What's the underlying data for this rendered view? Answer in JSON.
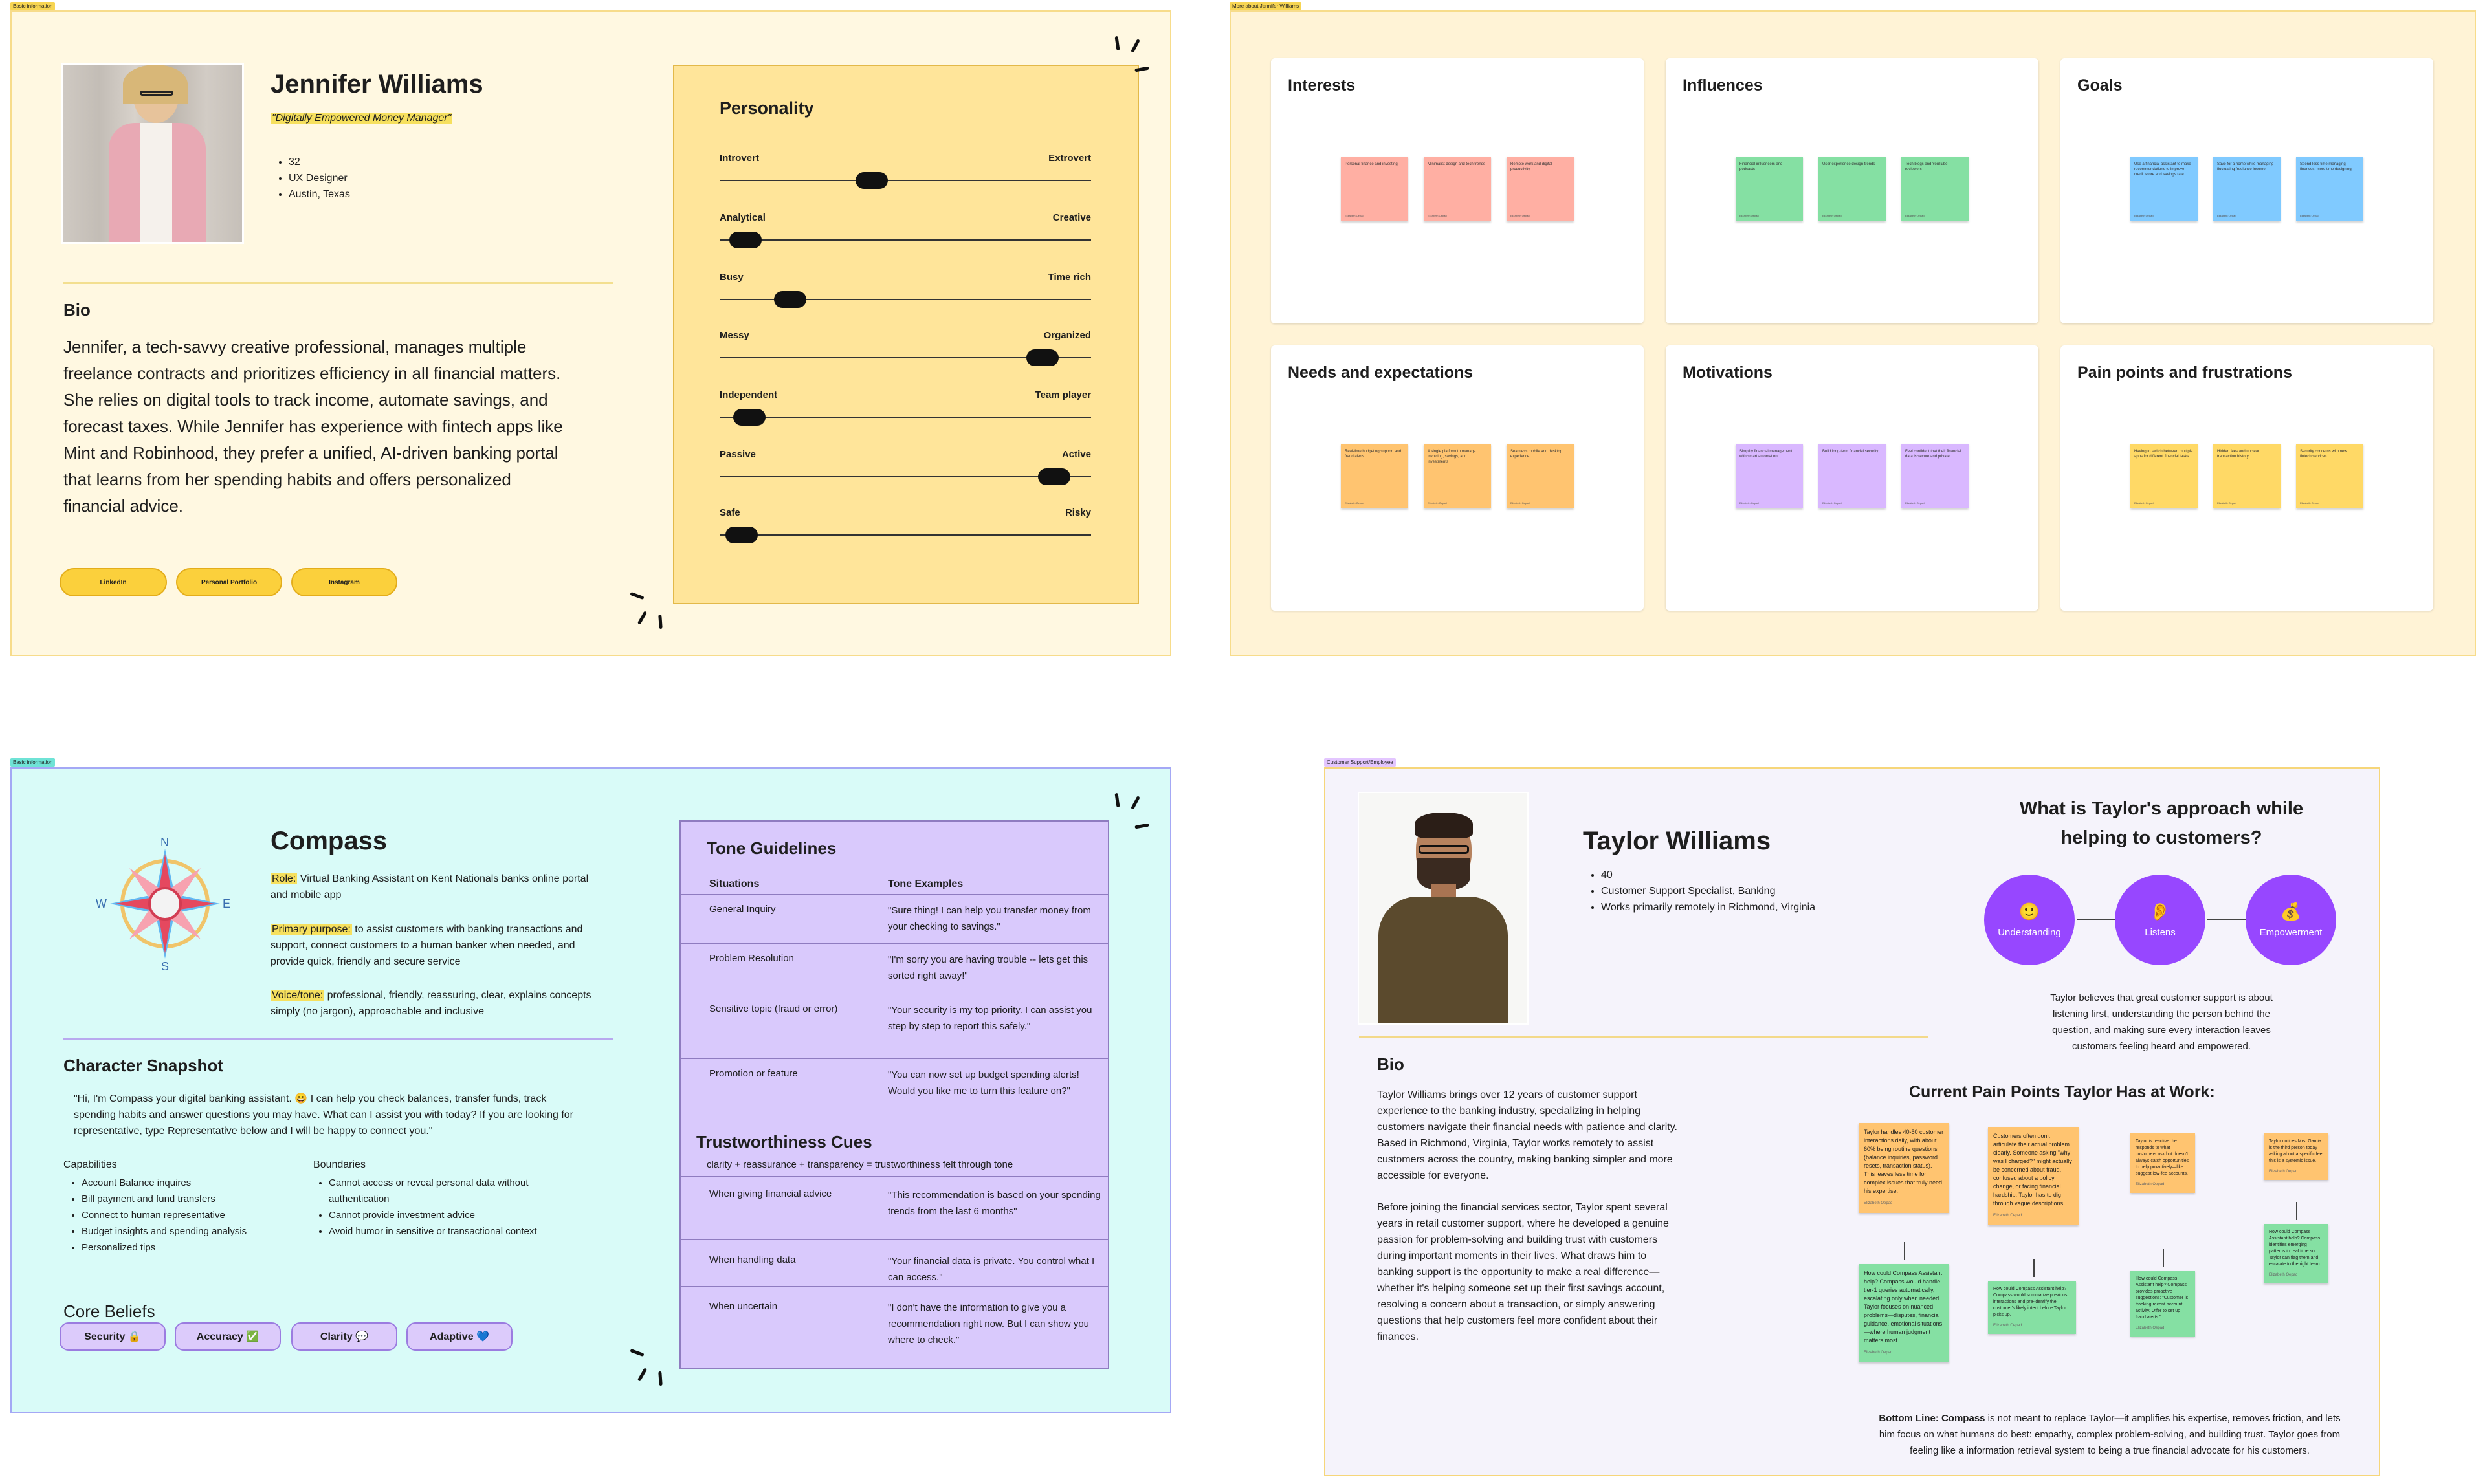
{
  "frame1": {
    "label": "Basic information",
    "name": "Jennifer Williams",
    "tagline": "\"Digitally Empowered Money Manager\"",
    "facts": [
      "32",
      "UX Designer",
      "Austin, Texas"
    ],
    "bio_heading": "Bio",
    "bio": "Jennifer, a tech-savvy creative professional, manages multiple freelance contracts and prioritizes efficiency in all financial matters. She relies on digital tools to track income, automate savings, and forecast taxes. While Jennifer has experience with fintech apps like Mint and Robinhood, they prefer a unified, AI-driven banking portal that learns from her spending habits and offers personalized financial advice.",
    "links": [
      "LinkedIn",
      "Personal Portfolio",
      "Instagram"
    ],
    "personality": {
      "title": "Personality",
      "sliders": [
        {
          "left": "Introvert",
          "right": "Extrovert",
          "value": 0.41
        },
        {
          "left": "Analytical",
          "right": "Creative",
          "value": 0.07
        },
        {
          "left": "Busy",
          "right": "Time rich",
          "value": 0.19
        },
        {
          "left": "Messy",
          "right": "Organized",
          "value": 0.87
        },
        {
          "left": "Independent",
          "right": "Team player",
          "value": 0.08
        },
        {
          "left": "Passive",
          "right": "Active",
          "value": 0.9
        },
        {
          "left": "Safe",
          "right": "Risky",
          "value": 0.06
        }
      ]
    }
  },
  "frame2": {
    "label": "More about Jennifer Williams",
    "cards": [
      {
        "title": "Interests",
        "color": "#ffafa3",
        "notes": [
          "Personal finance and investing",
          "Minimalist design and tech trends",
          "Remote work and digital productivity"
        ],
        "author": "Elizabeth Oepad"
      },
      {
        "title": "Influences",
        "color": "#85e0a3",
        "notes": [
          "Financial influencers and podcasts",
          "User experience design trends",
          "Tech blogs and YouTube reviewers"
        ],
        "author": "Elizabeth Oepad"
      },
      {
        "title": "Goals",
        "color": "#80caff",
        "notes": [
          "Use a financial assistant to make recommendations to improve credit score and savings rate",
          "Save for a home while managing fluctuating freelance income",
          "Spend less time managing finances, more time designing"
        ],
        "author": "Elizabeth Oepad"
      },
      {
        "title": "Needs and expectations",
        "color": "#ffc470",
        "notes": [
          "Real-time budgeting support and fraud alerts",
          "A single platform to manage invoicing, savings, and investments",
          "Seamless mobile and desktop experience"
        ],
        "author": "Elizabeth Oepad"
      },
      {
        "title": "Motivations",
        "color": "#d9b8ff",
        "notes": [
          "Simplify financial management with smart automation",
          "Build long-term financial security",
          "Feel confident that their financial data is secure and private"
        ],
        "author": "Elizabeth Oepad"
      },
      {
        "title": "Pain points and frustrations",
        "color": "#ffd966",
        "notes": [
          "Having to switch between multiple apps for different financial tasks",
          "Hidden fees and unclear transaction history",
          "Security concerns with new fintech services"
        ],
        "author": "Elizabeth Oepad"
      }
    ]
  },
  "frame3": {
    "label": "Basic information",
    "name": "Compass",
    "compass_letters": {
      "n": "N",
      "s": "S",
      "e": "E",
      "w": "W"
    },
    "role_label": "Role:",
    "role": " Virtual Banking Assistant on Kent Nationals banks online portal and mobile app",
    "purpose_label": "Primary purpose:",
    "purpose": " to assist customers with banking transactions and support, connect customers to a human banker when needed, and provide quick, friendly and secure service",
    "voice_label": "Voice/tone:",
    "voice": " professional, friendly, reassuring, clear, explains concepts simply (no jargon), approachable and inclusive",
    "snapshot_heading": "Character Snapshot",
    "snapshot_quote": "\"Hi, I'm Compass your digital banking assistant. 😀  I can help you check balances, transfer funds, track spending habits and answer questions you may have. What can I assist you with today? If you are looking for representative, type Representative below and I will be happy to connect you.\"",
    "capabilities_heading": "Capabilities",
    "capabilities": [
      "Account Balance inquires",
      "Bill payment and fund transfers",
      "Connect to human representative",
      "Budget insights and spending analysis",
      "Personalized tips"
    ],
    "boundaries_heading": "Boundaries",
    "boundaries": [
      "Cannot access or reveal personal data without authentication",
      "Cannot provide investment advice",
      "Avoid humor in sensitive or transactional context"
    ],
    "beliefs_heading": "Core Beliefs",
    "beliefs": [
      "Security 🔒",
      "Accuracy ✅",
      "Clarity 💬",
      "Adaptive 💙"
    ],
    "tone": {
      "title": "Tone Guidelines",
      "col_a": "Situations",
      "col_b": "Tone Examples",
      "rows": [
        {
          "a": "General Inquiry",
          "b": "\"Sure thing! I can help you transfer money from your checking to savings.\""
        },
        {
          "a": "Problem Resolution",
          "b": "\"I'm sorry you are having trouble -- lets get this sorted right away!\""
        },
        {
          "a": "Sensitive topic (fraud or error)",
          "b": "\"Your security is my top priority. I can assist you step by step to report this safely.\""
        },
        {
          "a": "Promotion or feature",
          "b": "\"You can now set up budget spending alerts! Would you like me to turn this feature on?\""
        }
      ],
      "trust_title": "Trustworthiness Cues",
      "trust_sub": "clarity + reassurance + transparency = trustworthiness felt through tone",
      "trust_rows": [
        {
          "a": "When giving financial advice",
          "b": "\"This recommendation is based on your spending trends from the last 6 months\""
        },
        {
          "a": "When handling data",
          "b": "\"Your financial data is private. You control what I can access.\""
        },
        {
          "a": "When uncertain",
          "b": "\"I don't have the information to give you a recommendation right now. But I can show you where to check.\""
        }
      ]
    }
  },
  "frame4": {
    "label": "Customer Support/Employee",
    "name": "Taylor Williams",
    "facts": [
      "40",
      "Customer Support Specialist, Banking",
      "Works primarily remotely in Richmond, Virginia"
    ],
    "approach_title": "What is Taylor's approach while helping to customers?",
    "circles": [
      {
        "icon": "🙂",
        "label": "Understanding"
      },
      {
        "icon": "👂",
        "label": "Listens"
      },
      {
        "icon": "💰",
        "label": "Empowerment"
      }
    ],
    "approach_text": "Taylor believes that great customer support is about listening first, understanding the person behind the question, and making sure every interaction leaves customers feeling heard and empowered.",
    "bio_heading": "Bio",
    "bio1": "Taylor Williams brings over 12 years of customer support experience to the banking industry, specializing in helping customers navigate their financial needs with patience and clarity. Based in Richmond, Virginia, Taylor works remotely to assist customers across the country, making banking simpler and more accessible for everyone.",
    "bio2": "Before joining the financial services sector, Taylor spent several years in retail customer support, where he developed a genuine passion for problem-solving and building trust with customers during important moments in their lives. What draws him to banking support is the opportunity to make a real difference—whether it's helping someone set up their first savings account, resolving a concern about a transaction, or simply answering questions that help customers feel more confident about their finances.",
    "pain_title": "Current Pain Points Taylor Has at Work:",
    "pain_notes": [
      {
        "text": "Taylor handles 40-50 customer interactions daily, with about 60% being routine questions (balance inquiries, password resets, transaction status). This leaves less time for complex issues that truly need his expertise.",
        "author": "Elizabeth Oepad",
        "color": "#ffc470"
      },
      {
        "text": "Customers often don't articulate their actual problem clearly. Someone asking \"why was I charged?\" might actually be concerned about fraud, confused about a policy change, or facing financial hardship. Taylor has to dig through vague descriptions.",
        "author": "Elizabeth Oepad",
        "color": "#ffc470"
      },
      {
        "text": "Taylor is reactive: he responds to what customers ask but doesn't always catch opportunities to help proactively—like suggest low-fee accounts.",
        "author": "Elizabeth Oepad",
        "color": "#ffc470"
      },
      {
        "text": "Taylor notices Mrs. Garcia is the third person today asking about a specific fee this is a systemic issue.",
        "author": "Elizabeth Oepad",
        "color": "#ffc470"
      }
    ],
    "help_notes": [
      {
        "text": "How could Compass Assistant help? Compass would handle tier-1 queries automatically, escalating only when needed. Taylor focuses on nuanced problems—disputes, financial guidance, emotional situations—where human judgment matters most.",
        "author": "Elizabeth Oepad"
      },
      {
        "text": "How could Compass Assistant help? Compass would summarize previous interactions and pre-identify the customer's likely intent before Taylor picks up.",
        "author": "Elizabeth Oepad"
      },
      {
        "text": "How could Compass Assistant help? Compass provides proactive suggestions: \"Customer is tracking recent account activity. Offer to set up fraud alerts.\"",
        "author": "Elizabeth Oepad"
      },
      {
        "text": "How could Compass Assistant help? Compass identifies emerging patterns in real time so Taylor can flag them and escalate to the right team.",
        "author": "Elizabeth Oepad"
      }
    ],
    "bottom_label": "Bottom Line: Compass",
    "bottom_text": " is not meant to replace Taylor—it amplifies his expertise, removes friction, and lets him focus on what humans do best: empathy, complex problem-solving, and building trust. Taylor goes from feeling like a information retrieval system to being a true financial advocate for his customers."
  }
}
